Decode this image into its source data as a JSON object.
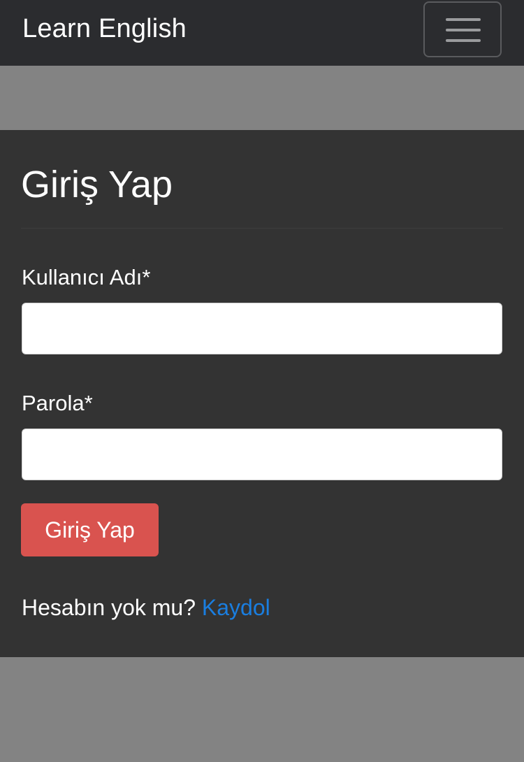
{
  "navbar": {
    "brand": "Learn English",
    "toggler_icon": "hamburger-menu-icon"
  },
  "login": {
    "title": "Giriş Yap",
    "username_label": "Kullanıcı Adı*",
    "username_value": "",
    "password_label": "Parola*",
    "password_value": "",
    "submit_label": "Giriş Yap",
    "no_account_text": "Hesabın yok mu?",
    "signup_link": "Kaydol"
  },
  "colors": {
    "navbar_bg": "#2b2c2f",
    "page_bg": "#838383",
    "card_bg": "#333333",
    "submit_button": "#d9534f",
    "link": "#1a7ee0"
  }
}
